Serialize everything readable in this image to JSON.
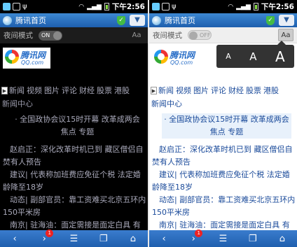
{
  "status_bar": {
    "time": "下午2:56",
    "icons": [
      "app-icon",
      "notification-icon",
      "usb-icon",
      "wifi-icon",
      "signal-icon",
      "battery-icon"
    ]
  },
  "title_bar": {
    "page_title": "腾讯首页",
    "menu_icon": "chevron-down-icon"
  },
  "toolbar": {
    "night_mode_label": "夜间模式",
    "toggle_on": "ON",
    "toggle_off": "OFF",
    "font_button": "Aa"
  },
  "logo": {
    "brand": "腾讯网",
    "domain": "QQ.com"
  },
  "nav": {
    "items": [
      "新闻",
      "视频",
      "图片",
      "评论",
      "财经",
      "股票",
      "港股"
    ]
  },
  "section_title": "新闻中心",
  "headline": "· 全国政协会议15时开幕 改革成两会焦点 专题",
  "news_items": [
    "赵启正：深化改革时机已到 藏区僧侣自焚有人预告",
    "建议| 代表称加班费应免征个税 法定婚龄降至18岁",
    "动态| 副部官员：靠工资难买北京五环内150平米房",
    "南京| 驻海油：面定需接是面定白具 有"
  ],
  "font_popup": {
    "small": "A",
    "medium": "A",
    "large": "A"
  },
  "bottom_bar": {
    "badge": "1"
  },
  "colors": {
    "title_bar": "#2f74c4",
    "link": "#1a4a9a",
    "night_bg": "#000000"
  }
}
